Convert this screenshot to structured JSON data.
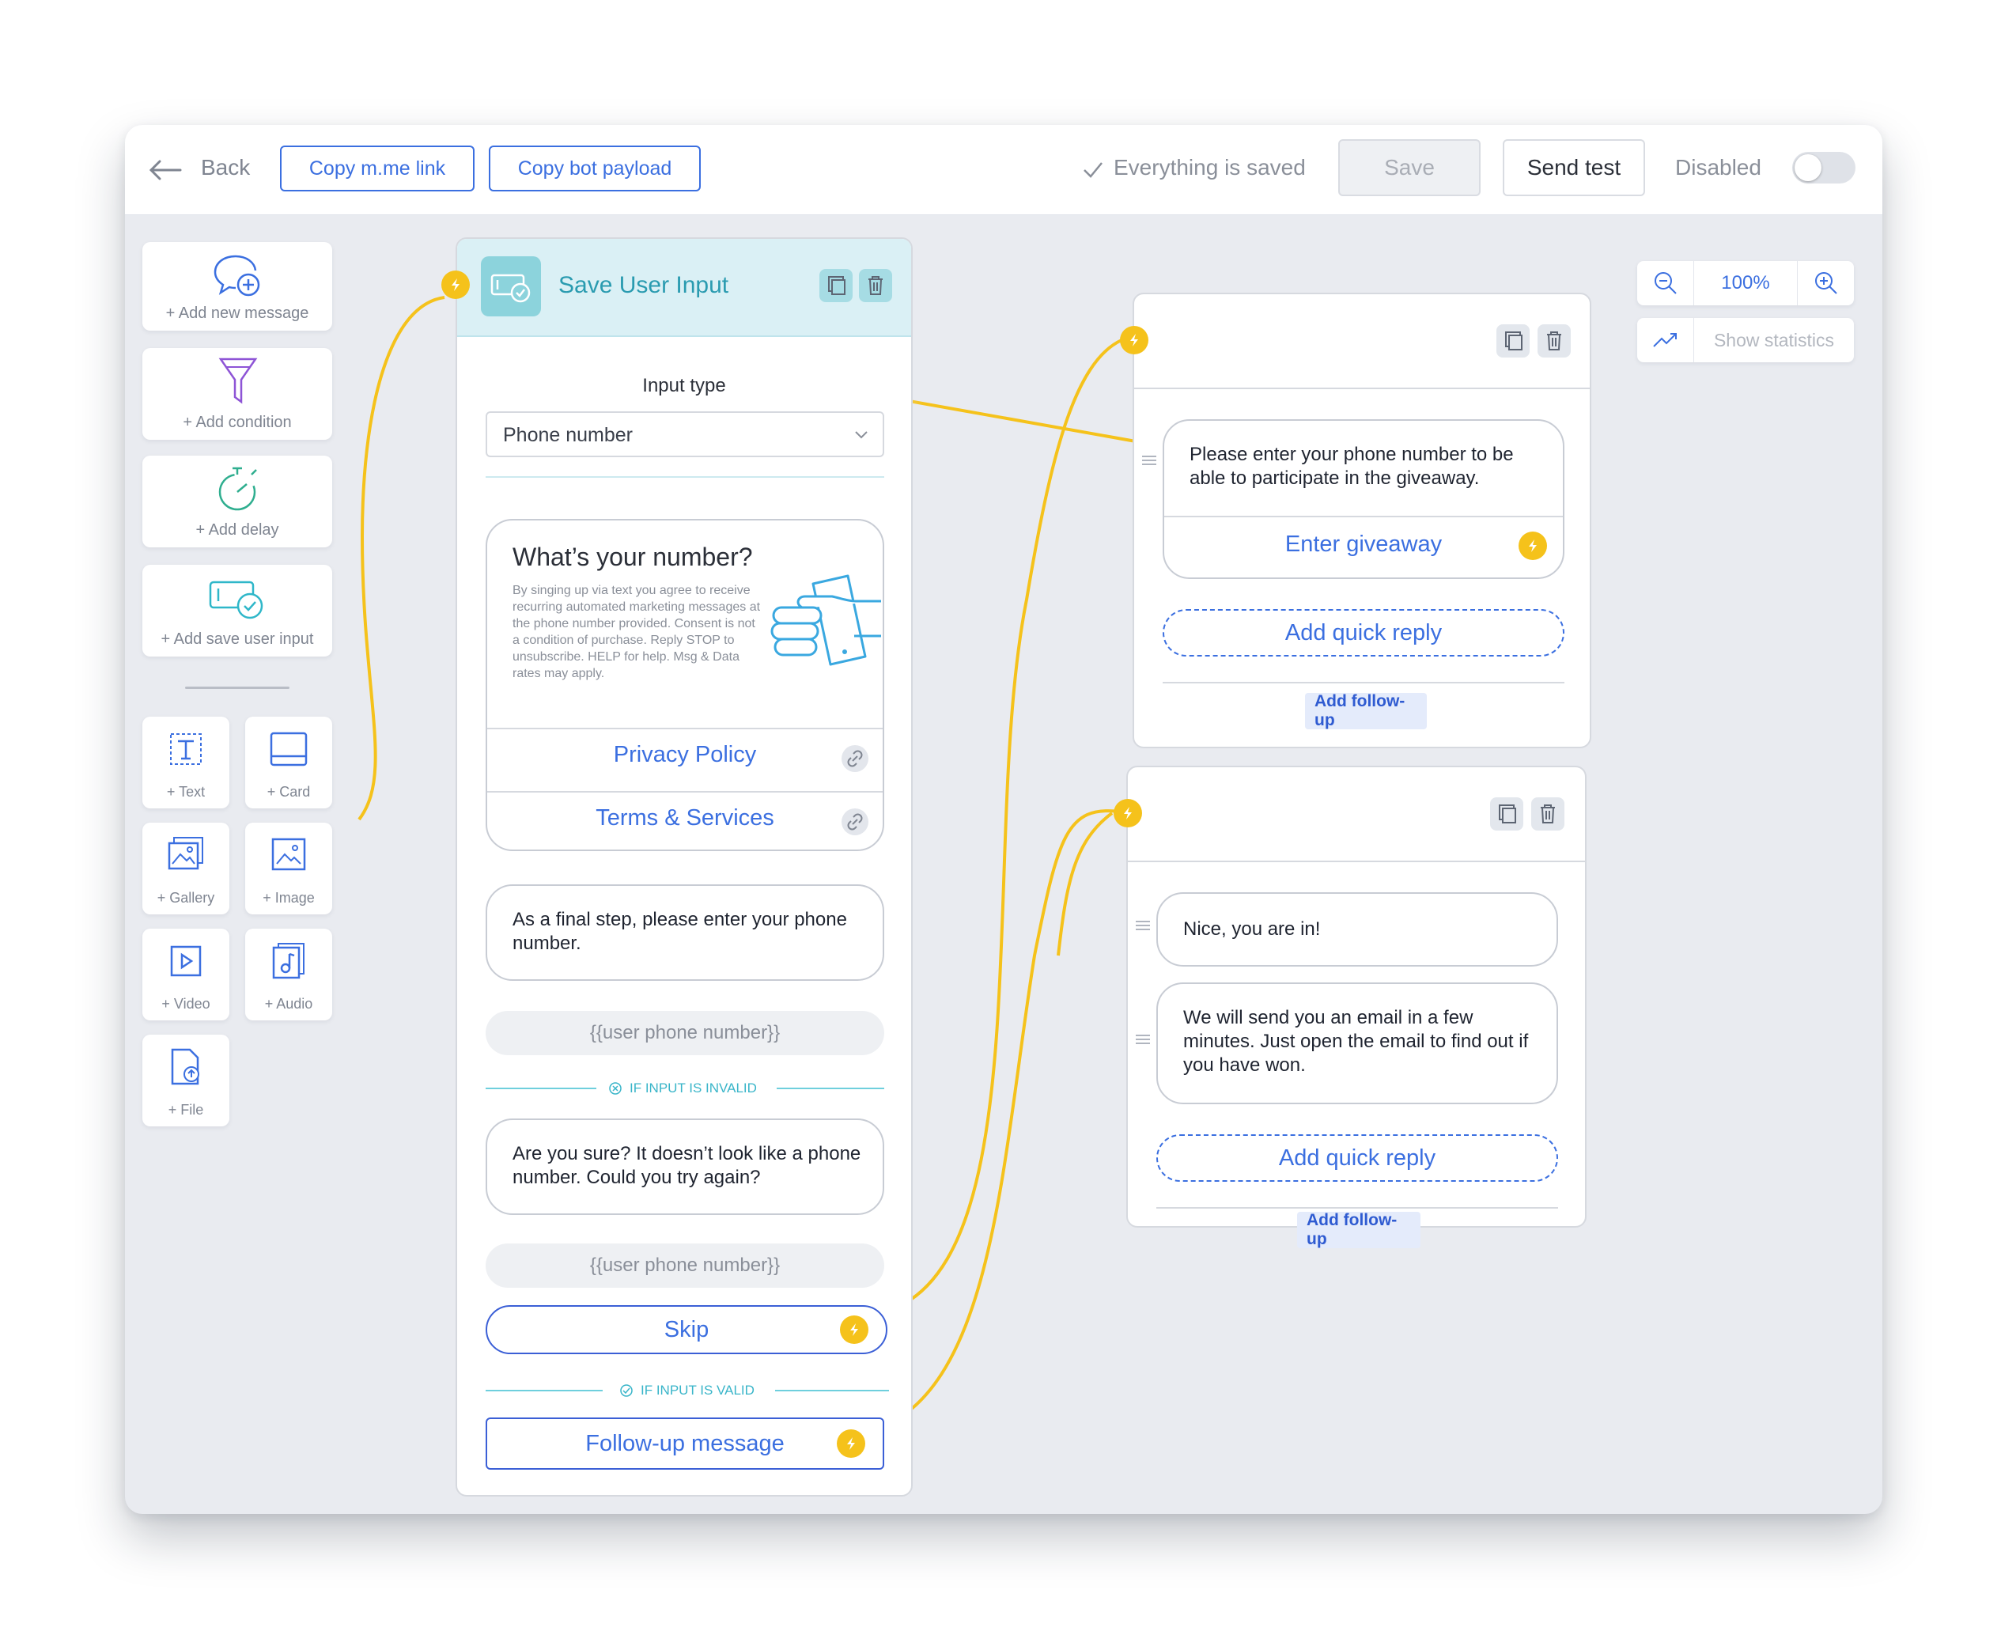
{
  "topbar": {
    "back_label": "Back",
    "copy_link_label": "Copy m.me link",
    "copy_payload_label": "Copy bot payload",
    "saved_status": "Everything is saved",
    "save_label": "Save",
    "send_test_label": "Send test",
    "disabled_label": "Disabled",
    "toggle_on": false
  },
  "toolbox": {
    "add_message": "+ Add new message",
    "add_condition": "+ Add condition",
    "add_delay": "+ Add delay",
    "add_save_input": "+ Add save user input",
    "items": [
      {
        "label": "+ Text",
        "icon": "text-icon"
      },
      {
        "label": "+ Card",
        "icon": "card-icon"
      },
      {
        "label": "+ Gallery",
        "icon": "gallery-icon"
      },
      {
        "label": "+ Image",
        "icon": "image-icon"
      },
      {
        "label": "+ Video",
        "icon": "video-icon"
      },
      {
        "label": "+ Audio",
        "icon": "audio-icon"
      },
      {
        "label": "+ File",
        "icon": "file-icon"
      }
    ]
  },
  "zoom": {
    "value": "100%",
    "show_statistics": "Show statistics"
  },
  "save_input_node": {
    "title": "Save User Input",
    "input_type_label": "Input type",
    "input_type_value": "Phone number",
    "card": {
      "title": "What’s your number?",
      "body": "By singing up via text you agree to receive recurring automated marketing messages at the phone number provided. Consent is not a condition of purchase. Reply STOP to unsubscribe. HELP for help. Msg & Data rates may apply.",
      "link1": "Privacy Policy",
      "link2": "Terms & Services"
    },
    "prompt_message": "As a final step, please enter your phone number.",
    "variable": "{{user phone number}}",
    "invalid_label": "IF INPUT IS INVALID",
    "retry_message": "Are you sure? It doesn’t look like a phone number. Could you try again?",
    "variable2": "{{user phone number}}",
    "skip_label": "Skip",
    "valid_label": "IF INPUT IS VALID",
    "followup_label": "Follow-up message"
  },
  "message_node_1": {
    "message": "Please enter your phone number to be able to participate in the giveaway.",
    "button": "Enter giveaway",
    "add_quick_reply": "Add quick reply",
    "add_followup": "Add follow-up"
  },
  "message_node_2": {
    "message1": "Nice, you are in!",
    "message2": "We will send you an email in a few minutes. Just open the email to find out if you have won.",
    "add_quick_reply": "Add quick reply",
    "add_followup": "Add follow-up"
  },
  "colors": {
    "accent_blue": "#3b6fe0",
    "connector_yellow": "#f5c21b",
    "header_teal": "#daf0f5",
    "canvas": "#e9ebf0"
  }
}
